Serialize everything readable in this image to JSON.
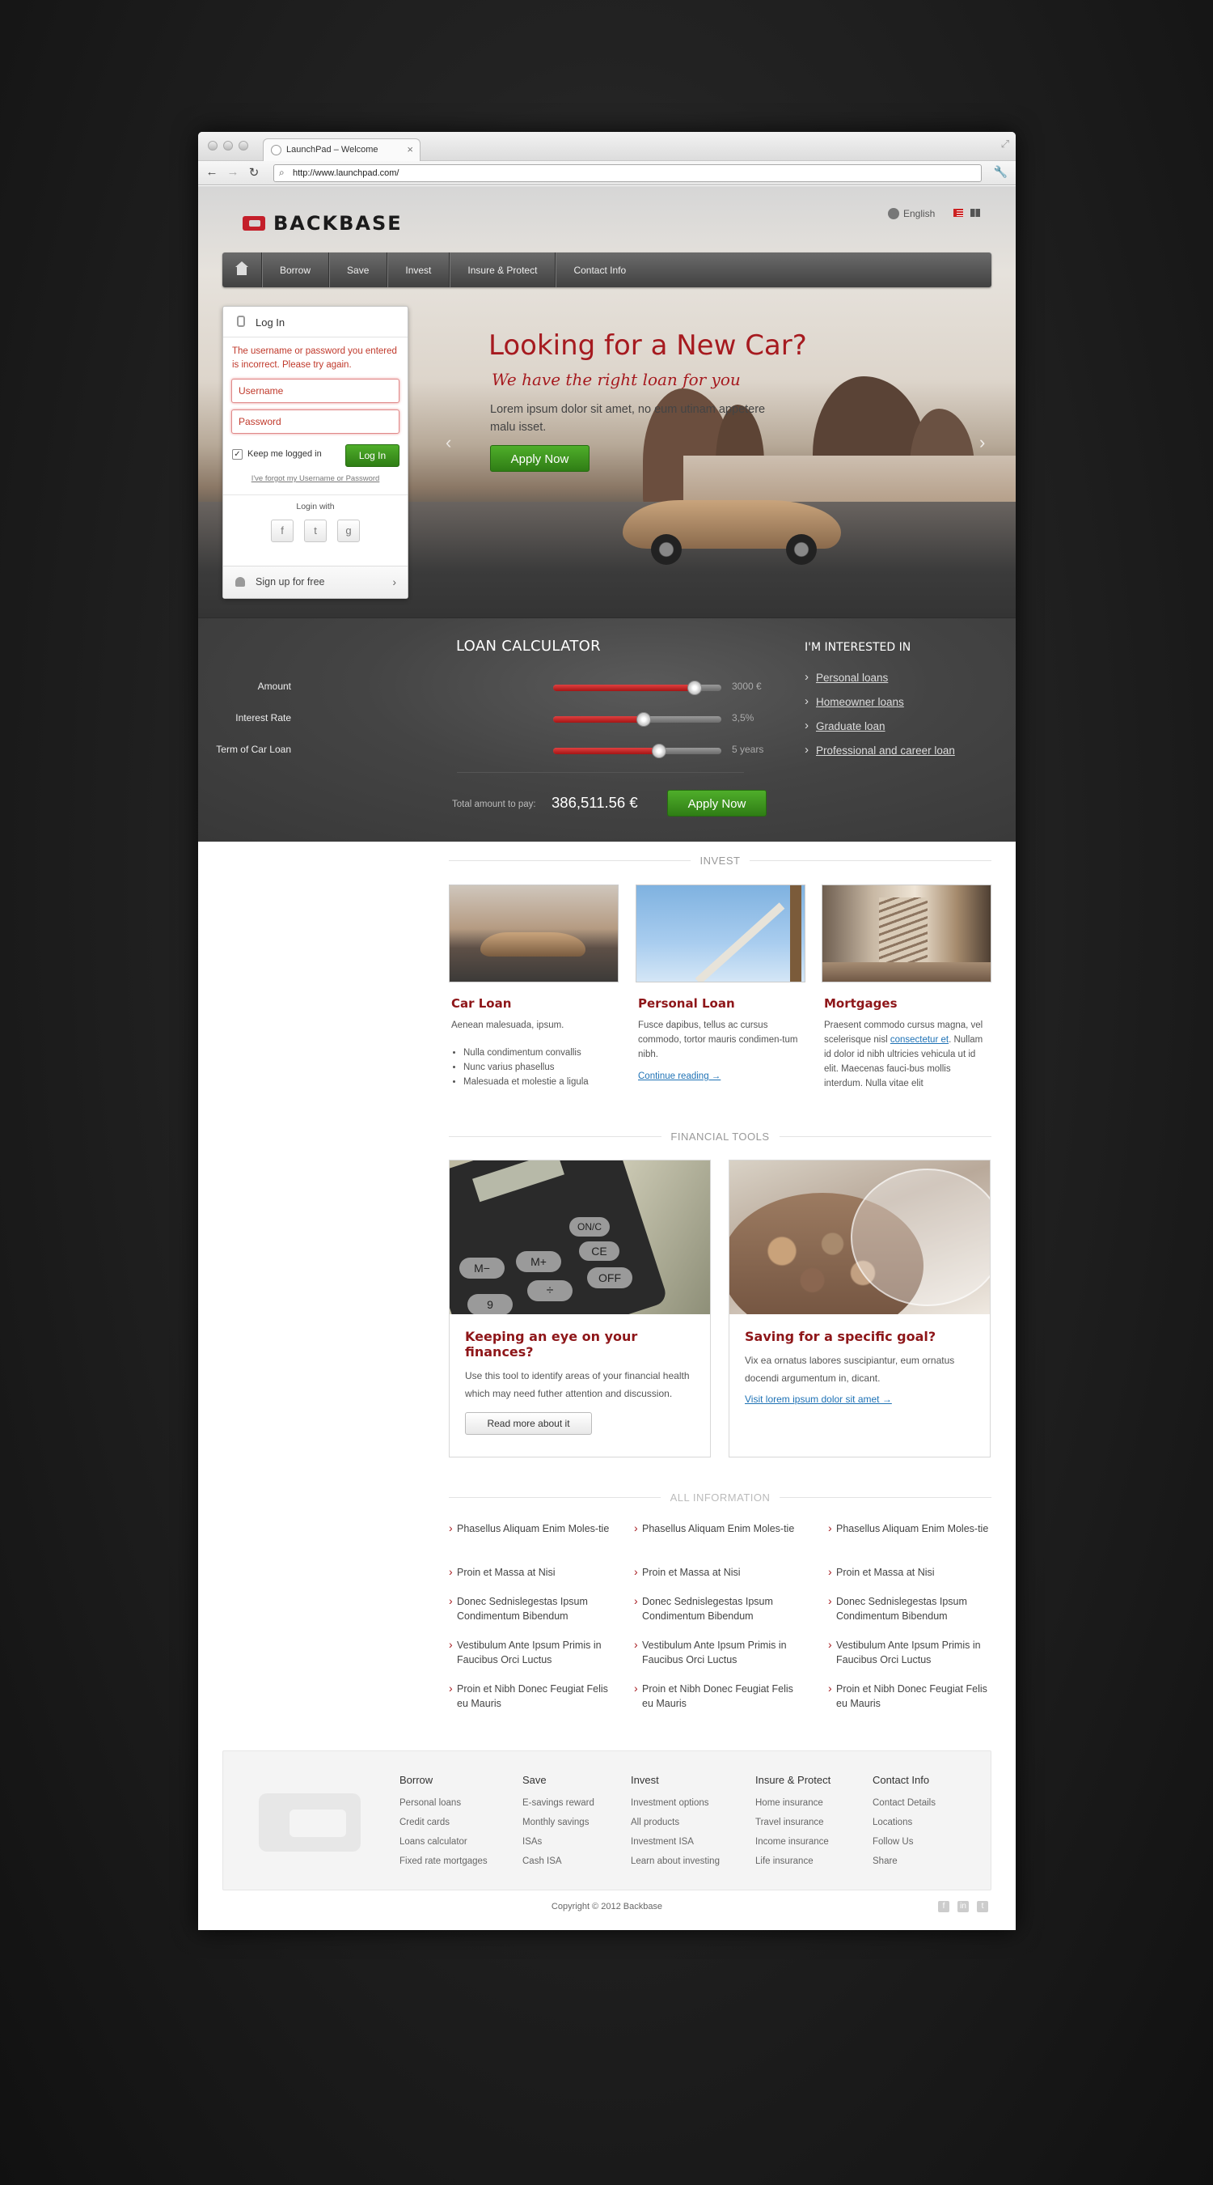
{
  "browser": {
    "tab_title": "LaunchPad – Welcome",
    "tab_close": "×",
    "url": "http://www.launchpad.com/"
  },
  "header": {
    "brand": "BACKBASE",
    "language": "English"
  },
  "nav": {
    "items": [
      "Borrow",
      "Save",
      "Invest",
      "Insure & Protect",
      "Contact Info"
    ]
  },
  "login": {
    "title": "Log In",
    "error": "The username or password you entered is incorrect. Please try again.",
    "username_placeholder": "Username",
    "password_placeholder": "Password",
    "keep_logged_in": "Keep me logged in",
    "keep_checked": true,
    "login_button": "Log In",
    "forgot": "I've forgot my Username or Password",
    "login_with": "Login with",
    "social": [
      "f",
      "t",
      "g"
    ],
    "signup": "Sign up for free"
  },
  "hero": {
    "title": "Looking for a New Car?",
    "subtitle": "We have the right loan for you",
    "text": "Lorem ipsum dolor sit amet, no eum utinam appetere malu isset.",
    "apply": "Apply Now"
  },
  "calculator": {
    "title": "LOAN CALCULATOR",
    "sliders": [
      {
        "label": "Amount",
        "value": "3000 €",
        "level": 0.84
      },
      {
        "label": "Interest Rate",
        "value": "3,5%",
        "level": 0.54
      },
      {
        "label": "Term of Car Loan",
        "value": "5 years",
        "level": 0.63
      }
    ],
    "total_label": "Total amount to pay:",
    "total_value": "386,511.56 €",
    "apply": "Apply Now"
  },
  "interest": {
    "title": "I'M INTERESTED IN",
    "items": [
      "Personal loans",
      "Homeowner loans",
      "Graduate loan",
      "Professional and career loan"
    ]
  },
  "invest": {
    "heading": "INVEST",
    "car": {
      "title": "Car Loan",
      "text": "Aenean malesuada, ipsum.",
      "bullets": [
        "Nulla condimentum convallis",
        "Nunc varius phasellus",
        "Malesuada et molestie a ligula"
      ]
    },
    "personal": {
      "title": "Personal Loan",
      "text": "Fusce dapibus, tellus ac cursus commodo, tortor mauris condimen-tum nibh.",
      "link": "Continue reading →"
    },
    "mortgages": {
      "title": "Mortgages",
      "text_before": "Praesent commodo cursus magna, vel scelerisque nisl ",
      "link": "consectetur et",
      "text_after": ". Nullam id dolor id nibh ultricies vehicula ut id elit. Maecenas fauci-bus mollis interdum. Nulla vitae elit"
    }
  },
  "tools": {
    "heading": "FINANCIAL TOOLS",
    "calc_keys": [
      "ON/C",
      "CE",
      "M−",
      "M+",
      "÷",
      "OFF",
      "9"
    ],
    "finances": {
      "title": "Keeping an eye on your finances?",
      "text": "Use this tool to identify areas of your financial health which may need futher attention and discussion.",
      "button": "Read more about it"
    },
    "saving": {
      "title": "Saving for a specific goal?",
      "text": "Vix ea ornatus labores suscipiantur, eum ornatus docendi argumentum in, dicant.",
      "link": "Visit lorem ipsum dolor sit amet →"
    }
  },
  "all_info": {
    "heading": "ALL INFORMATION",
    "columns": [
      [
        "Phasellus Aliquam Enim Moles-tie",
        "Proin et Massa at Nisi",
        "Donec Sednislegestas Ipsum Condimentum Bibendum",
        "Vestibulum Ante Ipsum Primis in Faucibus Orci Luctus",
        "Proin et Nibh Donec Feugiat Felis eu Mauris"
      ],
      [
        "Phasellus Aliquam Enim Moles-tie",
        "Proin et Massa at Nisi",
        "Donec Sednislegestas Ipsum Condimentum Bibendum",
        "Vestibulum Ante Ipsum Primis in Faucibus Orci Luctus",
        "Proin et Nibh Donec Feugiat Felis eu Mauris"
      ],
      [
        "Phasellus Aliquam Enim Moles-tie",
        "Proin et Massa at Nisi",
        "Donec Sednislegestas Ipsum Condimentum Bibendum",
        "Vestibulum Ante Ipsum Primis in Faucibus Orci Luctus",
        "Proin et Nibh Donec Feugiat Felis eu Mauris"
      ]
    ]
  },
  "footer": {
    "columns": [
      {
        "title": "Borrow",
        "items": [
          "Personal loans",
          "Credit cards",
          "Loans calculator",
          "Fixed rate mortgages"
        ]
      },
      {
        "title": "Save",
        "items": [
          "E-savings reward",
          "Monthly savings",
          "ISAs",
          "Cash ISA"
        ]
      },
      {
        "title": "Invest",
        "items": [
          "Investment options",
          "All products",
          "Investment ISA",
          "Learn about investing"
        ]
      },
      {
        "title": "Insure & Protect",
        "items": [
          "Home insurance",
          "Travel insurance",
          "Income insurance",
          "Life insurance"
        ]
      },
      {
        "title": "Contact Info",
        "items": [
          "Contact Details",
          "Locations",
          "Follow Us",
          "Share"
        ]
      }
    ],
    "copyright": "Copyright © 2012 Backbase",
    "social": [
      "f",
      "in",
      "t"
    ]
  },
  "colors": {
    "brand_red": "#a61a1f",
    "accent_green": "#3d9a1f",
    "link_blue": "#1f72b5"
  }
}
